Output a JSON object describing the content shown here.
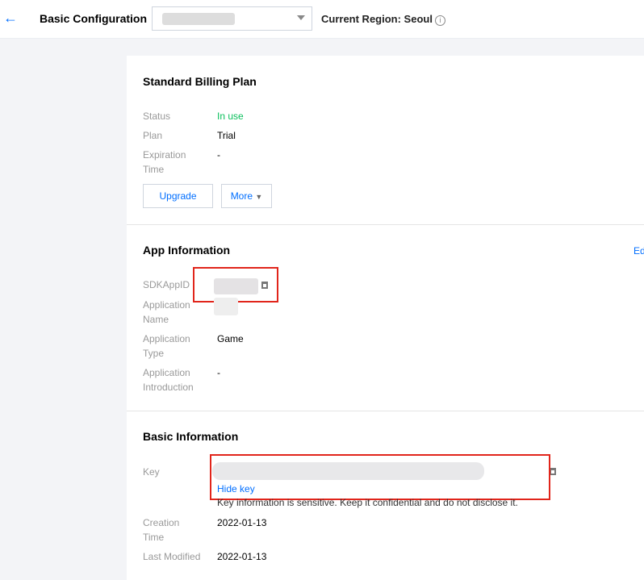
{
  "header": {
    "back_icon": "arrow-left-icon",
    "title": "Basic Configuration",
    "app_select_value": "",
    "region": "Current Region: Seoul"
  },
  "billing": {
    "title": "Standard Billing Plan",
    "rows": [
      {
        "label": "Status",
        "value": "In use"
      },
      {
        "label": "Plan",
        "value": "Trial"
      },
      {
        "label": "Expiration Time",
        "value": "-"
      }
    ],
    "upgrade": "Upgrade",
    "more": "More"
  },
  "app": {
    "title": "App Information",
    "edit": "Ed",
    "rows": [
      {
        "label": "SDKAppID",
        "value": ""
      },
      {
        "label": "Application Name",
        "value": ""
      },
      {
        "label": "Application Type",
        "value": "Game"
      },
      {
        "label": "Application Introduction",
        "value": "-"
      }
    ]
  },
  "basic": {
    "title": "Basic Information",
    "key_label": "Key",
    "hide_key": "Hide key",
    "notice": "Key information is sensitive. Keep it confidential and do not disclose it.",
    "rows": [
      {
        "label": "Creation Time",
        "value": "2022-01-13"
      },
      {
        "label": "Last Modified",
        "value": "2022-01-13"
      }
    ]
  },
  "colors": {
    "accent": "#006eff",
    "success": "#0abf5b",
    "highlight": "#e1251b"
  }
}
